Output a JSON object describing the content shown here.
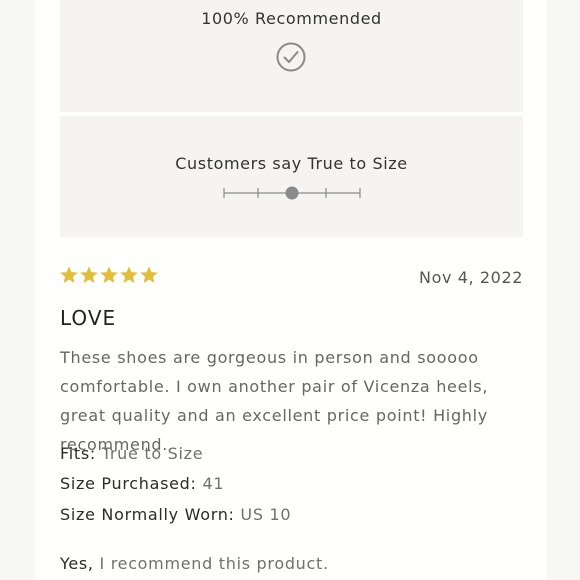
{
  "recommendation": {
    "label": "100% Recommended",
    "icon": "check-circle-icon"
  },
  "fit": {
    "label": "Customers say True to Size",
    "slider_steps": 5,
    "slider_selected_index": 2
  },
  "review": {
    "rating": 5,
    "rating_max": 5,
    "star_color": "#e3bd3a",
    "date": "Nov 4, 2022",
    "title": "LOVE",
    "body": "These shoes are gorgeous in person and sooooo comfortable. I own another pair of Vicenza heels, great quality and an excellent price point! Highly recommend.",
    "attributes": {
      "fits_label": "Fits:",
      "fits_value": "True to Size",
      "size_purchased_label": "Size Purchased:",
      "size_purchased_value": "41",
      "size_worn_label": "Size Normally Worn:",
      "size_worn_value": "US 10"
    },
    "recommend": {
      "answer": "Yes,",
      "text": "I recommend this product."
    }
  }
}
